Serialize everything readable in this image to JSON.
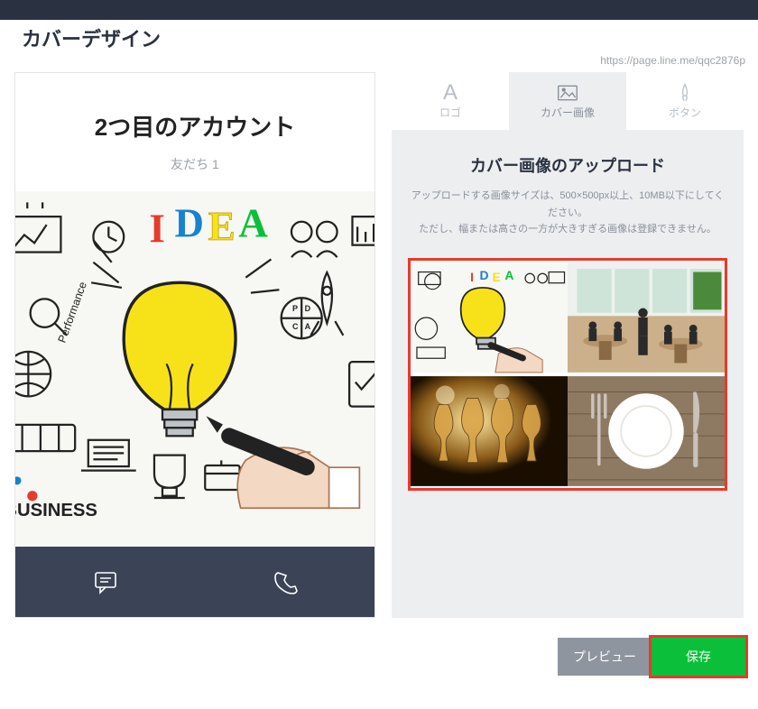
{
  "header": {
    "title": "カバーデザイン"
  },
  "url": "https://page.line.me/qqc2876p",
  "preview": {
    "account_name": "2つ目のアカウント",
    "friends_label": "友だち 1"
  },
  "tabs": {
    "logo": "ロゴ",
    "cover_image": "カバー画像",
    "button": "ボタン"
  },
  "upload": {
    "title": "カバー画像のアップロード",
    "hint1": "アップロードする画像サイズは、500×500px以上、10MB以下にしてください。",
    "hint2": "ただし、幅または高さの一方が大きすぎる画像は登録できません。"
  },
  "cover_text": {
    "idea": "IDEA",
    "pdca": "PDCA",
    "performance": "Performance",
    "business": "BUSINESS"
  },
  "actions": {
    "preview": "プレビュー",
    "save": "保存"
  },
  "gallery": {
    "items": [
      "idea-sketch",
      "cafe-interior",
      "wine-glasses",
      "plate-cutlery"
    ]
  }
}
